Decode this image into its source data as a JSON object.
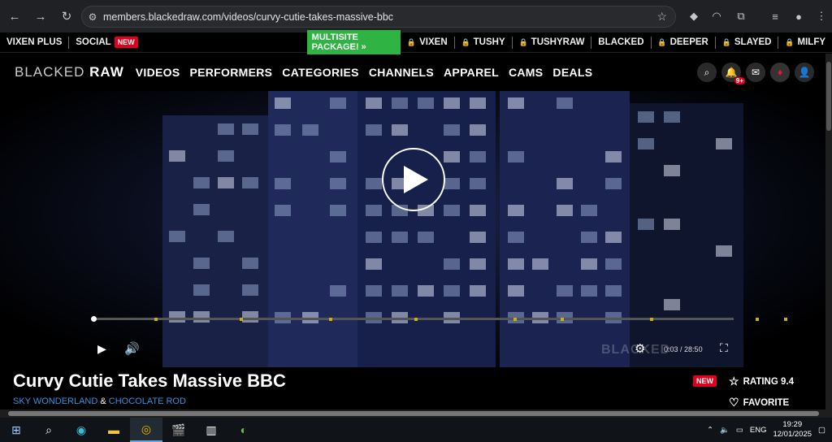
{
  "browser": {
    "url": "members.blackedraw.com/videos/curvy-cutie-takes-massive-bbc"
  },
  "network_bar": {
    "left_items": [
      {
        "label": "VIXEN PLUS"
      },
      {
        "label": "SOCIAL",
        "badge": "NEW"
      }
    ],
    "multisite": "MULTISITE PACKAGE! »",
    "sites": [
      "VIXEN",
      "TUSHY",
      "TUSHYRAW",
      "BLACKED",
      "DEEPER",
      "SLAYED",
      "MILFY"
    ]
  },
  "site": {
    "logo_light": "BLACKED",
    "logo_bold": "RAW",
    "nav": [
      "VIDEOS",
      "PERFORMERS",
      "CATEGORIES",
      "CHANNELS",
      "APPAREL",
      "CAMS",
      "DEALS"
    ],
    "notification_count": "9+"
  },
  "player": {
    "current_time": "0:03",
    "duration": "/ 28:50",
    "progress_fraction": 0.002,
    "watermark": "BLACKED"
  },
  "video_info": {
    "title": "Curvy Cutie Takes Massive BBC",
    "performer_1": "SKY WONDERLAND",
    "joiner": "&",
    "performer_2": "CHOCOLATE ROD",
    "badge": "NEW",
    "rating": "RATING 9.4",
    "favorite": "FAVORITE"
  },
  "taskbar": {
    "language": "ENG",
    "time": "19:29",
    "date": "12/01/2025"
  },
  "colors": {
    "accent_red": "#e0001b",
    "multisite_green": "#2fb343",
    "performer_blue": "#3b8fe0"
  }
}
